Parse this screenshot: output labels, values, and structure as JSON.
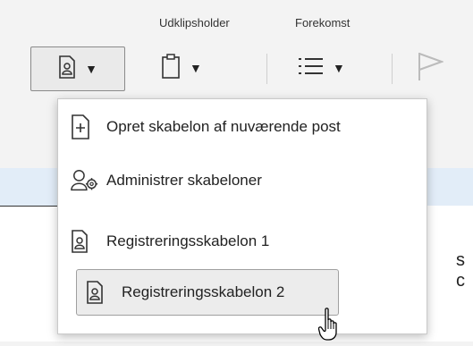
{
  "ribbon": {
    "groups": [
      {
        "label": "Udklipsholder"
      },
      {
        "label": "Forekomst"
      }
    ],
    "buttons": [
      {
        "name": "template-button",
        "icon": "document-person-icon",
        "active": true
      },
      {
        "name": "clipboard-button",
        "icon": "clipboard-icon"
      },
      {
        "name": "list-button",
        "icon": "list-icon"
      },
      {
        "name": "flag-button",
        "icon": "flag-icon"
      }
    ]
  },
  "background": {
    "partial_text": "s c"
  },
  "menu": {
    "items": [
      {
        "label": "Opret skabelon af nuværende post",
        "icon": "new-document-plus-icon"
      },
      {
        "label": "Administrer skabeloner",
        "icon": "user-settings-icon"
      },
      {
        "label": "Registreringsskabelon 1",
        "icon": "document-person-icon"
      },
      {
        "label": "Registreringsskabelon 2",
        "icon": "document-person-icon",
        "hovered": true
      }
    ]
  },
  "cursor": {
    "icon": "hand-pointer-icon"
  }
}
